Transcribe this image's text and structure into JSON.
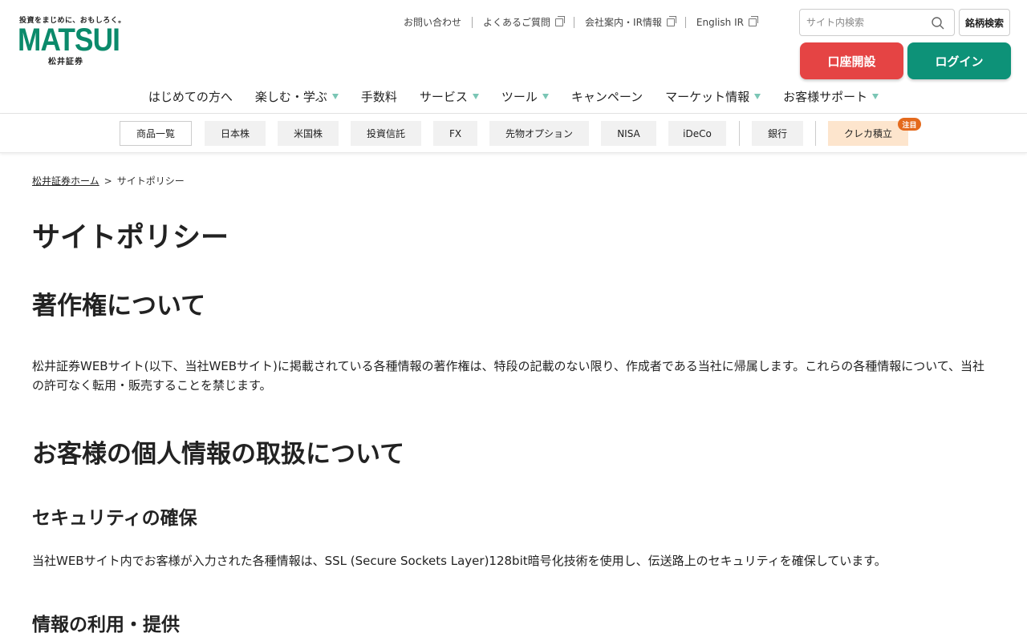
{
  "logo": {
    "tagline": "投資をまじめに、おもしろく。",
    "wordmark": "MATSUI",
    "company_name": "松井証券"
  },
  "util_links": [
    {
      "label": "お問い合わせ",
      "external": false
    },
    {
      "label": "よくあるご質問",
      "external": true
    },
    {
      "label": "会社案内・IR情報",
      "external": true
    },
    {
      "label": "English IR",
      "external": true
    }
  ],
  "search": {
    "placeholder": "サイト内検索",
    "ticker_button": "銘柄検索"
  },
  "actions": {
    "open_account": "口座開設",
    "login": "ログイン"
  },
  "main_nav": [
    {
      "label": "はじめての方へ",
      "dropdown": false
    },
    {
      "label": "楽しむ・学ぶ",
      "dropdown": true
    },
    {
      "label": "手数料",
      "dropdown": false
    },
    {
      "label": "サービス",
      "dropdown": true
    },
    {
      "label": "ツール",
      "dropdown": true
    },
    {
      "label": "キャンペーン",
      "dropdown": false
    },
    {
      "label": "マーケット情報",
      "dropdown": true
    },
    {
      "label": "お客様サポート",
      "dropdown": true
    }
  ],
  "sub_nav": {
    "items": [
      "商品一覧",
      "日本株",
      "米国株",
      "投資信託",
      "FX",
      "先物オプション",
      "NISA",
      "iDeCo",
      "銀行",
      "クレカ積立"
    ],
    "badge": "注目"
  },
  "breadcrumb": {
    "home": "松井証券ホーム",
    "separator": ">",
    "current": "サイトポリシー"
  },
  "content": {
    "page_title": "サイトポリシー",
    "copyright_heading": "著作権について",
    "copyright_text": "松井証券WEBサイト(以下、当社WEBサイト)に掲載されている各種情報の著作権は、特段の記載のない限り、作成者である当社に帰属します。これらの各種情報について、当社の許可なく転用・販売することを禁じます。",
    "privacy_heading": "お客様の個人情報の取扱について",
    "security_heading": "セキュリティの確保",
    "security_text": "当社WEBサイト内でお客様が入力された各種情報は、SSL (Secure Sockets Layer)128bit暗号化技術を使用し、伝送路上のセキュリティを確保しています。",
    "usage_heading": "情報の利用・提供"
  }
}
